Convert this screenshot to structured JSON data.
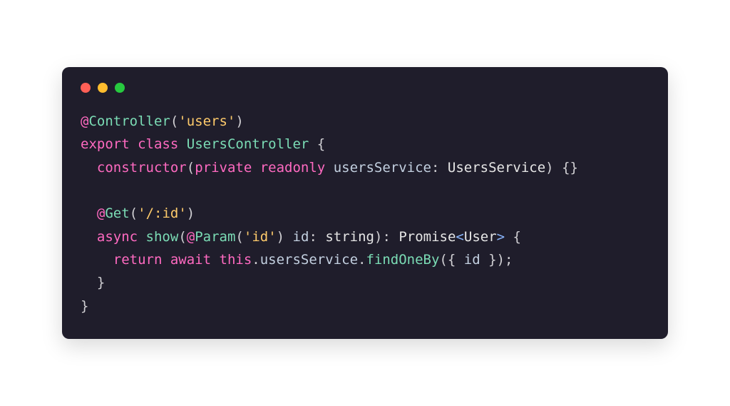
{
  "window": {
    "trafficColors": {
      "close": "#ff5f56",
      "minimize": "#ffbd2e",
      "zoom": "#27c93f"
    }
  },
  "code": {
    "line1": {
      "at": "@",
      "decName": "Controller",
      "lparen": "(",
      "arg": "'users'",
      "rparen": ")"
    },
    "line2": {
      "kwExport": "export",
      "kwClass": "class",
      "className": "UsersController",
      "lbrace": "{"
    },
    "line3": {
      "indent": "  ",
      "ctor": "constructor",
      "lparen": "(",
      "kwPrivate": "private",
      "kwReadonly": "readonly",
      "paramName": "usersService",
      "colon": ":",
      "paramType": "UsersService",
      "rparen": ")",
      "body": "{}"
    },
    "line4": {
      "blank": ""
    },
    "line5": {
      "indent": "  ",
      "at": "@",
      "decName": "Get",
      "lparen": "(",
      "arg": "'/:id'",
      "rparen": ")"
    },
    "line6": {
      "indent": "  ",
      "kwAsync": "async",
      "fnName": "show",
      "lparen": "(",
      "at": "@",
      "decName": "Param",
      "dlparen": "(",
      "decArg": "'id'",
      "drparen": ")",
      "paramName": "id",
      "colon1": ":",
      "paramType": "string",
      "rparen": ")",
      "colon2": ":",
      "retType": "Promise",
      "lt": "<",
      "gen": "User",
      "gt": ">",
      "lbrace": "{"
    },
    "line7": {
      "indent": "    ",
      "kwReturn": "return",
      "kwAwait": "await",
      "kwThis": "this",
      "dot1": ".",
      "prop": "usersService",
      "dot2": ".",
      "method": "findOneBy",
      "lparen": "(",
      "lbrace": "{",
      "key": "id",
      "rbrace": "}",
      "rparen": ")",
      "semi": ";"
    },
    "line8": {
      "indent": "  ",
      "rbrace": "}"
    },
    "line9": {
      "rbrace": "}"
    }
  }
}
